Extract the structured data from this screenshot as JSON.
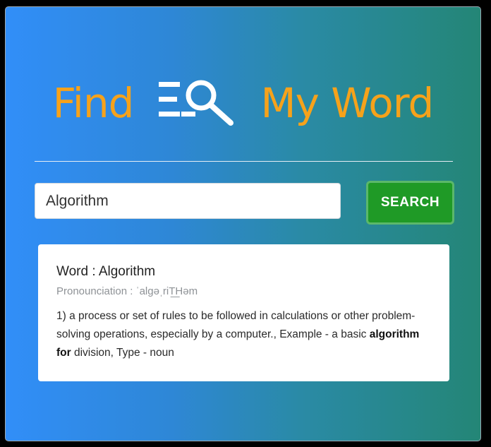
{
  "logo": {
    "left_text": "Find",
    "right_text": "My Word",
    "icon": "list-search-icon",
    "color": "#f6a21b"
  },
  "search": {
    "value": "Algorithm",
    "button_label": "SEARCH",
    "button_color": "#1f9a26"
  },
  "result": {
    "word_line": "Word : Algorithm",
    "pronunciation_line": "Pronounciation : ˈalɡəˌriT͟Həm",
    "definition_number": "1)",
    "definition": "a process or set of rules to be followed in calculations or other problem-solving operations, especially by a computer., Example - a basic",
    "example_bold": "algorithm for",
    "example_tail": "division, Type - noun"
  },
  "colors": {
    "gradient_start": "#318ef8",
    "gradient_end": "#248676",
    "card_background": "#ffffff"
  }
}
